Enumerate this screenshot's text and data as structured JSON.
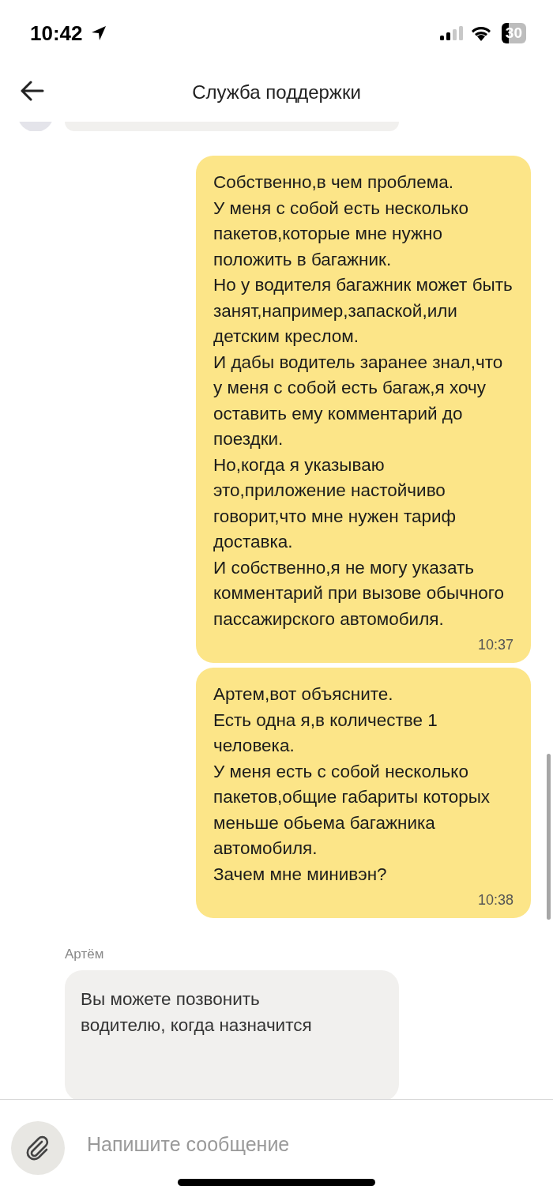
{
  "status_bar": {
    "time": "10:42",
    "battery": "30"
  },
  "header": {
    "title": "Служба поддержки"
  },
  "messages": [
    {
      "kind": "incoming_partial"
    },
    {
      "kind": "outgoing",
      "text": "Собственно,в чем проблема.\nУ меня с собой есть несколько пакетов,которые мне нужно положить в багажник.\nНо у водителя багажник может быть занят,например,запаской,или детским креслом.\nИ дабы водитель заранее знал,что у меня с собой есть багаж,я хочу оставить ему комментарий до поездки.\nНо,когда я указываю это,приложение настойчиво говорит,что мне нужен тариф доставка.\nИ собственно,я не могу указать комментарий при вызове обычного пассажирского автомобиля.",
      "time": "10:37"
    },
    {
      "kind": "outgoing",
      "text": "Артем,вот объясните.\nЕсть одна я,в количестве 1 человека.\nУ меня есть с собой несколько пакетов,общие габариты которых меньше обьема багажника автомобиля.\nЗачем мне минивэн?",
      "time": "10:38"
    },
    {
      "kind": "incoming",
      "author": "Артём",
      "text": "Вы можете позвонить\nводителю, когда назначится"
    }
  ],
  "composer": {
    "placeholder": "Напишите сообщение"
  }
}
